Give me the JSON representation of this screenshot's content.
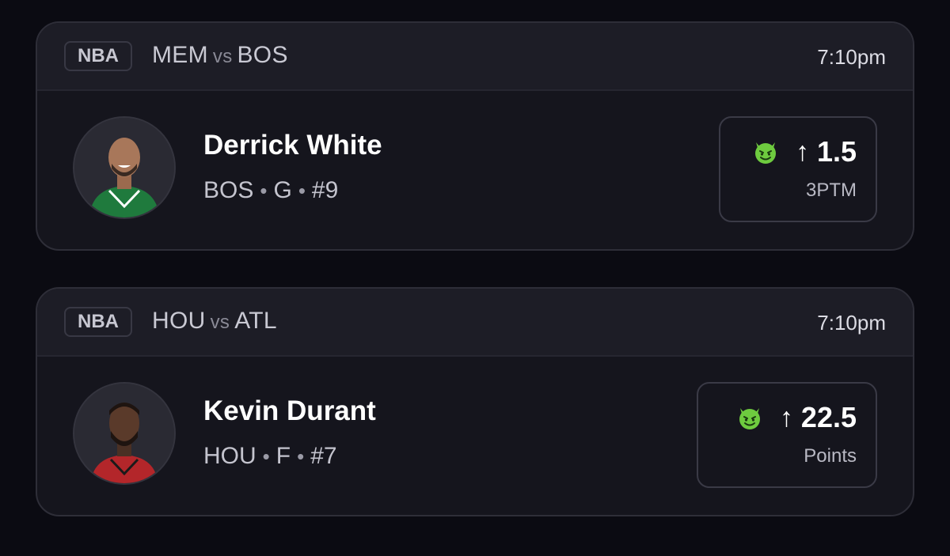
{
  "cards": [
    {
      "league": "NBA",
      "team_a": "MEM",
      "vs": "vs",
      "team_b": "BOS",
      "time": "7:10pm",
      "player": {
        "name": "Derrick White",
        "team": "BOS",
        "position": "G",
        "number": "#9",
        "jersey_color": "#1f7a3d"
      },
      "pick": {
        "icon": "demon-icon",
        "direction": "↑",
        "line": "1.5",
        "stat": "3PTM"
      }
    },
    {
      "league": "NBA",
      "team_a": "HOU",
      "vs": "vs",
      "team_b": "ATL",
      "time": "7:10pm",
      "player": {
        "name": "Kevin Durant",
        "team": "HOU",
        "position": "F",
        "number": "#7",
        "jersey_color": "#b3262a"
      },
      "pick": {
        "icon": "demon-icon",
        "direction": "↑",
        "line": "22.5",
        "stat": "Points"
      }
    }
  ],
  "meta_separator": "•",
  "colors": {
    "background": "#0b0b12",
    "card": "#15151d",
    "header": "#1d1d26",
    "demon_green": "#6ecb3f"
  }
}
